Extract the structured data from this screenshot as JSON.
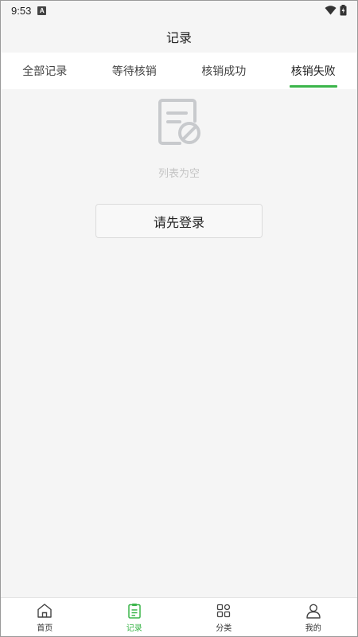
{
  "status_bar": {
    "time": "9:53",
    "notification_letter": "A",
    "icons": [
      "wifi-icon",
      "battery-icon"
    ]
  },
  "header": {
    "title": "记录"
  },
  "tabs": [
    {
      "label": "全部记录",
      "active": false
    },
    {
      "label": "等待核销",
      "active": false
    },
    {
      "label": "核销成功",
      "active": false
    },
    {
      "label": "核销失败",
      "active": true
    }
  ],
  "empty_state": {
    "icon": "empty-document-icon",
    "text": "列表为空",
    "login_button_label": "请先登录"
  },
  "bottom_nav": [
    {
      "label": "首页",
      "icon": "home-icon",
      "active": false
    },
    {
      "label": "记录",
      "icon": "clipboard-icon",
      "active": true
    },
    {
      "label": "分类",
      "icon": "category-grid-icon",
      "active": false
    },
    {
      "label": "我的",
      "icon": "user-icon",
      "active": false
    }
  ],
  "colors": {
    "accent": "#3bb54a",
    "background": "#f5f5f5",
    "empty_text": "#c4c4c4"
  }
}
